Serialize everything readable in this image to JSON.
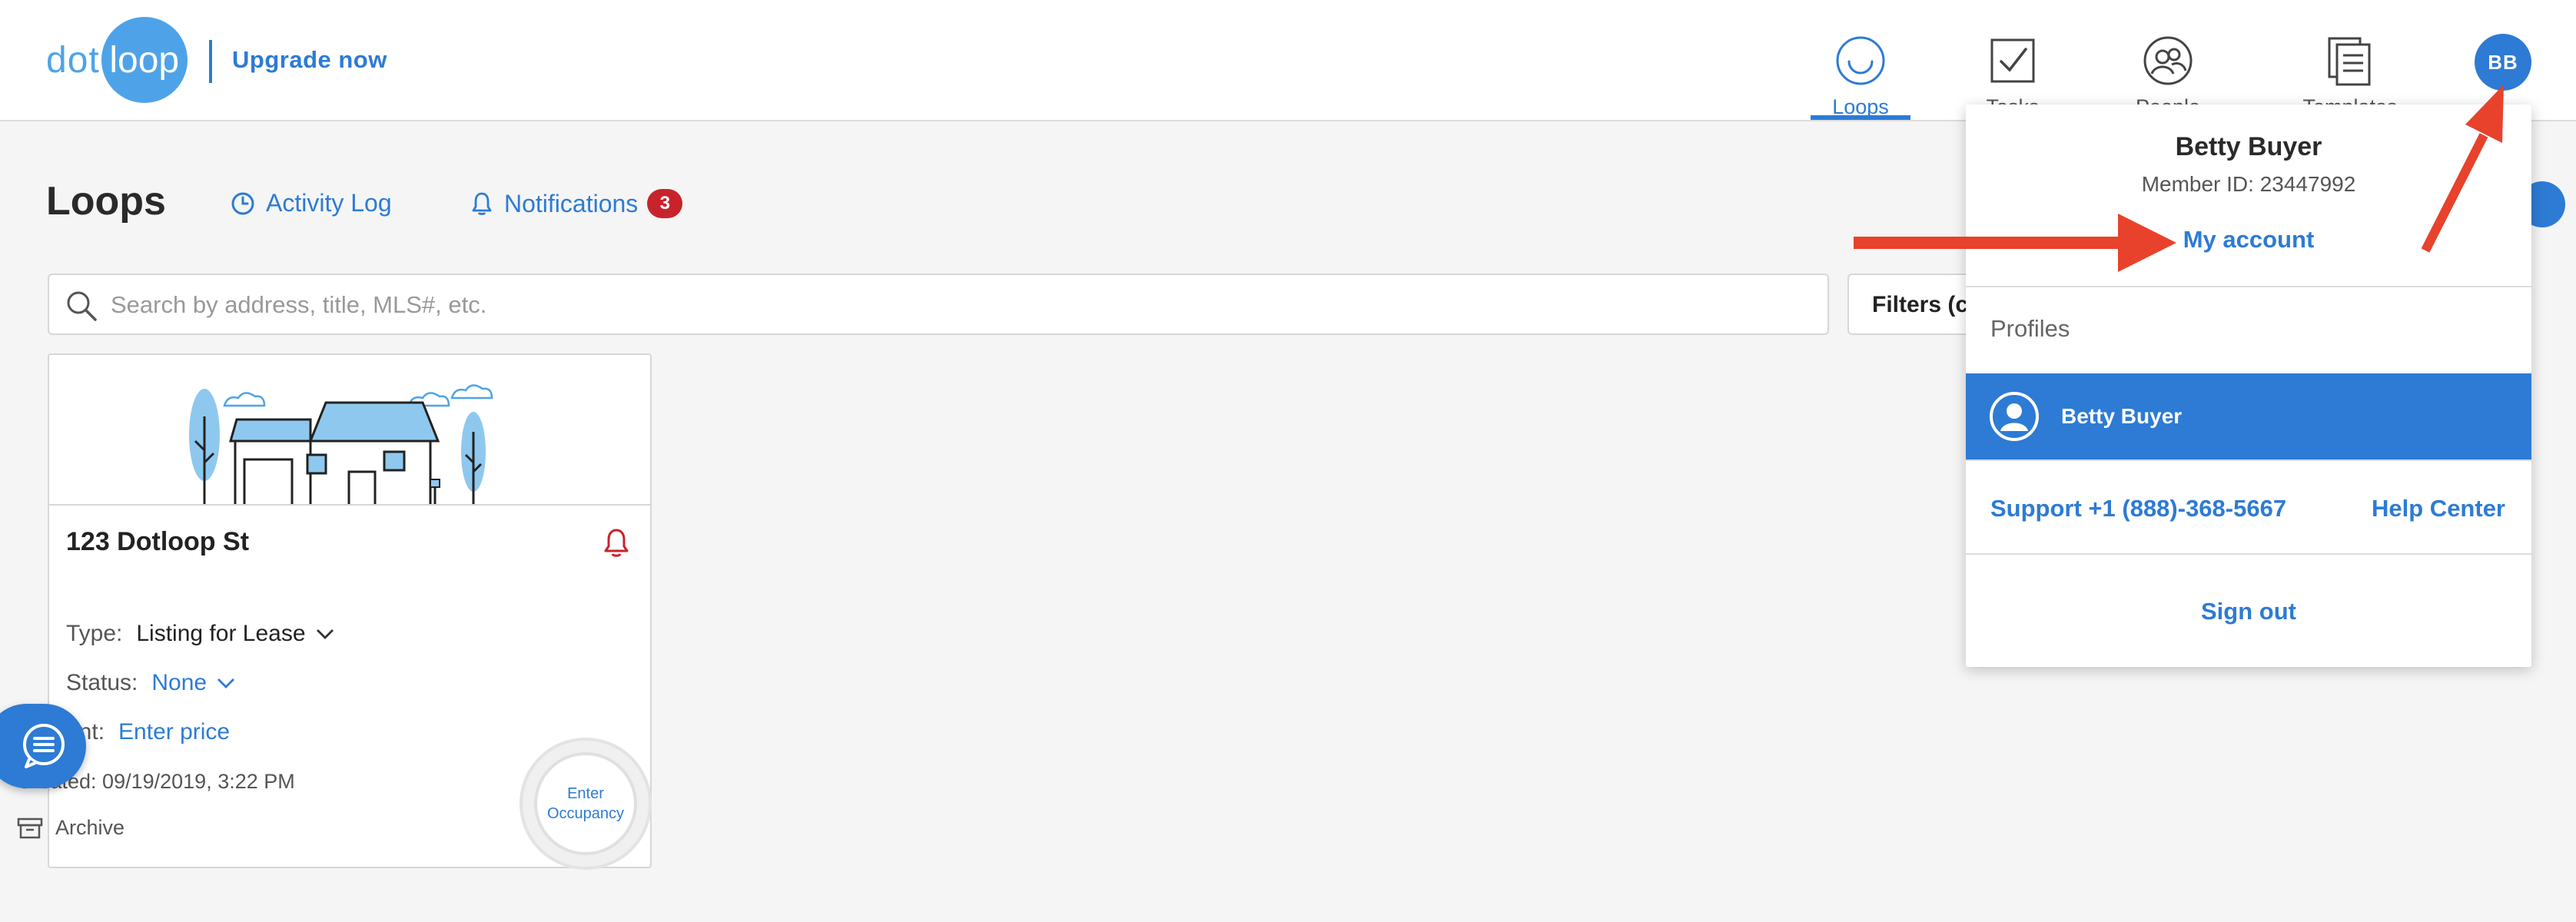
{
  "header": {
    "logo": {
      "part1": "dot",
      "part2": "loop"
    },
    "upgrade_label": "Upgrade now",
    "nav": [
      {
        "label": "Loops",
        "icon": "loops-icon",
        "active": true
      },
      {
        "label": "Tasks",
        "icon": "tasks-icon",
        "active": false
      },
      {
        "label": "People",
        "icon": "people-icon",
        "active": false
      },
      {
        "label": "Templates",
        "icon": "templates-icon",
        "active": false
      }
    ],
    "avatar_initials": "BB"
  },
  "subheader": {
    "title": "Loops",
    "activity_log_label": "Activity Log",
    "notifications_label": "Notifications",
    "notifications_count": "3"
  },
  "search": {
    "placeholder": "Search by address, title, MLS#, etc.",
    "value": "",
    "filters_label": "Filters (c"
  },
  "card": {
    "title": "123 Dotloop St",
    "type_label": "Type:",
    "type_value": "Listing for Lease",
    "status_label": "Status:",
    "status_value": "None",
    "rent_label": "ent:",
    "rent_value": "Enter price",
    "created": "Created: 09/19/2019, 3:22 PM",
    "archive_label": "Archive",
    "occupancy_line1": "Enter",
    "occupancy_line2": "Occupancy"
  },
  "dropdown": {
    "name": "Betty Buyer",
    "member_id": "Member ID: 23447992",
    "my_account_label": "My account",
    "profiles_label": "Profiles",
    "profile_name": "Betty Buyer",
    "support_label": "Support +1 (888)-368-5667",
    "help_center_label": "Help Center",
    "sign_out_label": "Sign out"
  },
  "colors": {
    "accent": "#2d7bd4",
    "logo_blue": "#4ea3e8",
    "badge_red": "#c8232c",
    "annotation_arrow": "#e8412c"
  }
}
